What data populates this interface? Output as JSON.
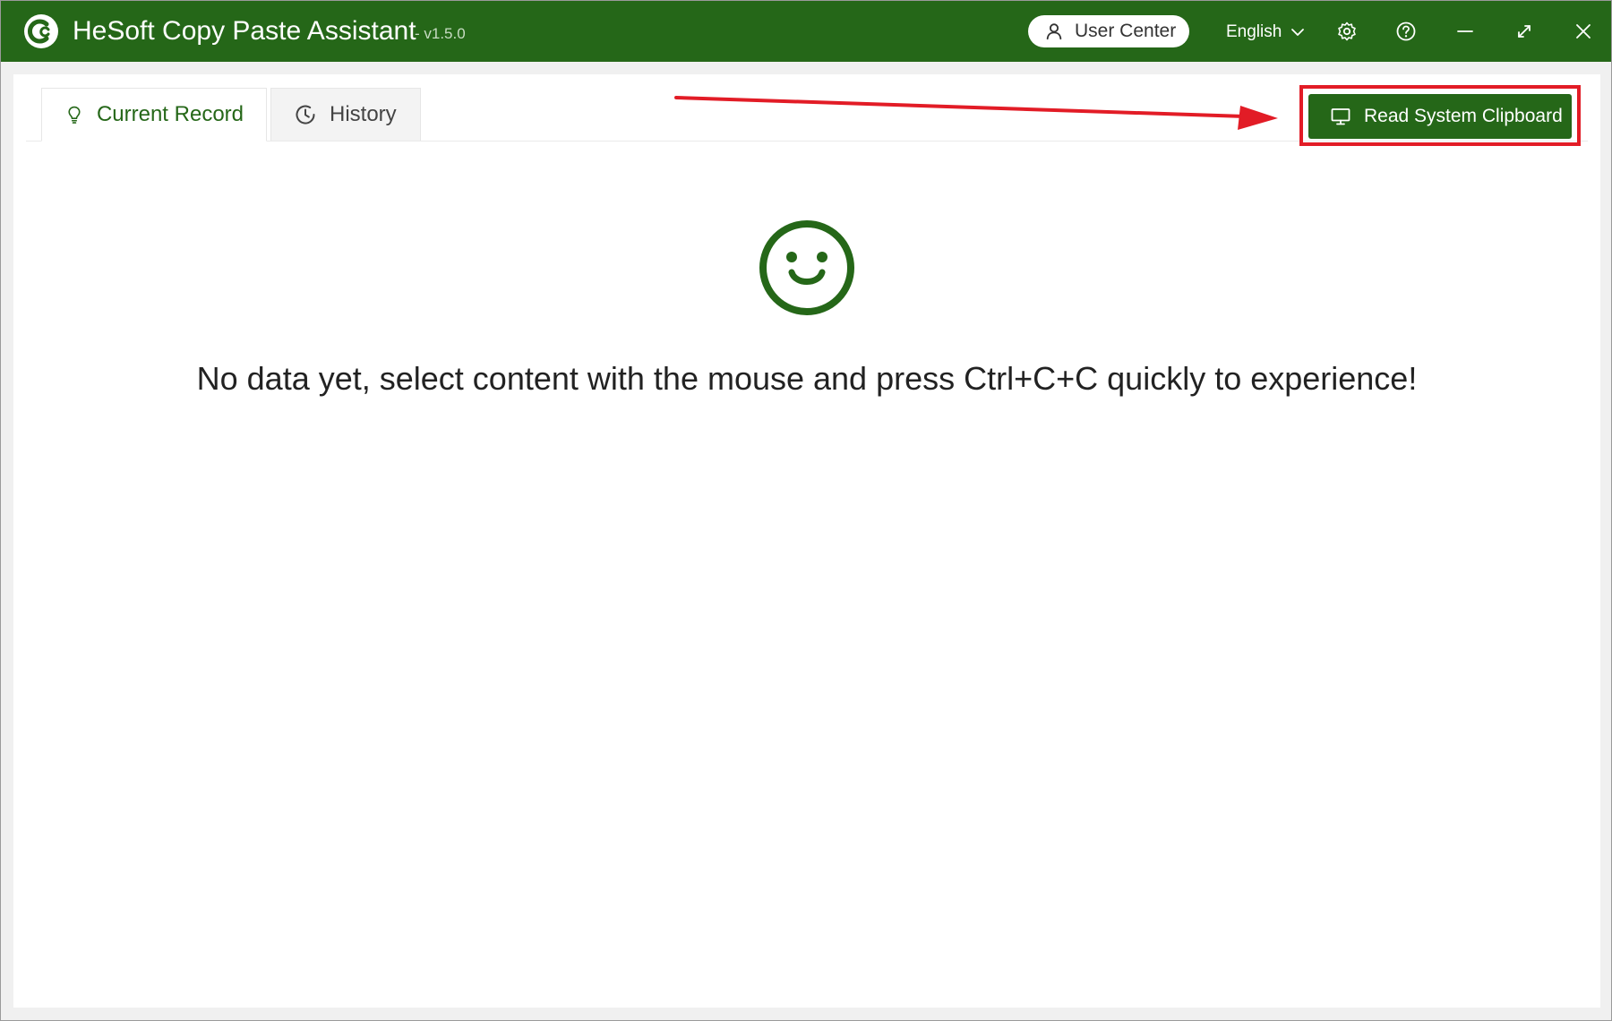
{
  "app": {
    "title": "HeSoft Copy Paste Assistant",
    "version": "- v1.5.0",
    "accent_color": "#256718"
  },
  "titlebar": {
    "logo_icon": "copy-paste-logo-icon",
    "user_center_label": "User Center",
    "user_icon": "user-icon",
    "language_label": "English",
    "language_icon": "chevron-down-icon",
    "settings_icon": "gear-icon",
    "help_icon": "help-icon",
    "minimize_icon": "minimize-icon",
    "maximize_icon": "expand-icon",
    "close_icon": "close-icon"
  },
  "tabs": [
    {
      "label": "Current Record",
      "icon": "lightbulb-icon",
      "active": true
    },
    {
      "label": "History",
      "icon": "clock-icon",
      "active": false
    }
  ],
  "toolbar": {
    "read_clipboard_label": "Read System Clipboard",
    "read_clipboard_icon": "monitor-icon"
  },
  "annotation": {
    "highlight_color": "#e21c26"
  },
  "empty_state": {
    "icon": "smiley-face-icon",
    "message": "No data yet, select content with the mouse and press Ctrl+C+C quickly to experience!"
  }
}
